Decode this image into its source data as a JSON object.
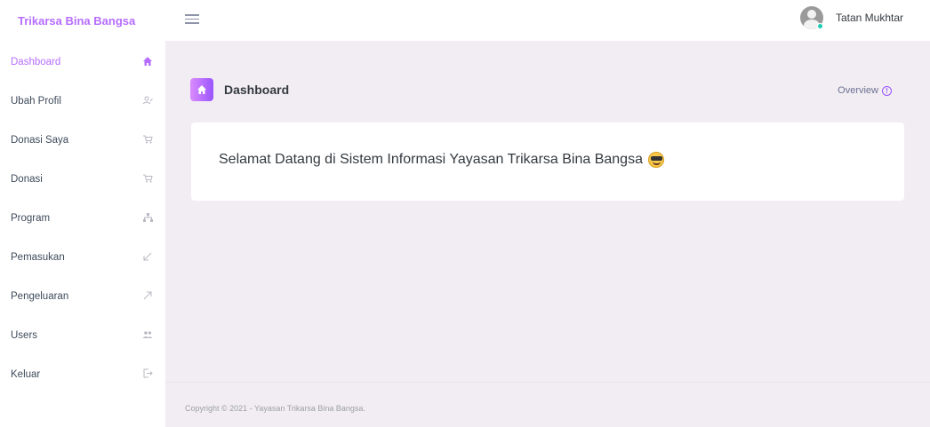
{
  "app": {
    "brand": "Trikarsa Bina Bangsa"
  },
  "header": {
    "user_name": "Tatan Mukhtar"
  },
  "sidebar": {
    "items": [
      {
        "label": "Dashboard",
        "icon": "home-icon",
        "active": true
      },
      {
        "label": "Ubah Profil",
        "icon": "user-edit-icon",
        "active": false
      },
      {
        "label": "Donasi Saya",
        "icon": "cart-icon",
        "active": false
      },
      {
        "label": "Donasi",
        "icon": "cart-icon",
        "active": false
      },
      {
        "label": "Program",
        "icon": "sitemap-icon",
        "active": false
      },
      {
        "label": "Pemasukan",
        "icon": "arrow-bottom-left-icon",
        "active": false
      },
      {
        "label": "Pengeluaran",
        "icon": "arrow-top-right-icon",
        "active": false
      },
      {
        "label": "Users",
        "icon": "users-icon",
        "active": false
      },
      {
        "label": "Keluar",
        "icon": "logout-icon",
        "active": false
      }
    ]
  },
  "main": {
    "title": "Dashboard",
    "overview_label": "Overview",
    "welcome": "Selamat Datang di Sistem Informasi Yayasan Trikarsa Bina Bangsa"
  },
  "footer": {
    "text": "Copyright © 2021 - Yayasan Trikarsa Bina Bangsa."
  },
  "colors": {
    "accent": "#b66dff",
    "background": "#f2edf3"
  }
}
